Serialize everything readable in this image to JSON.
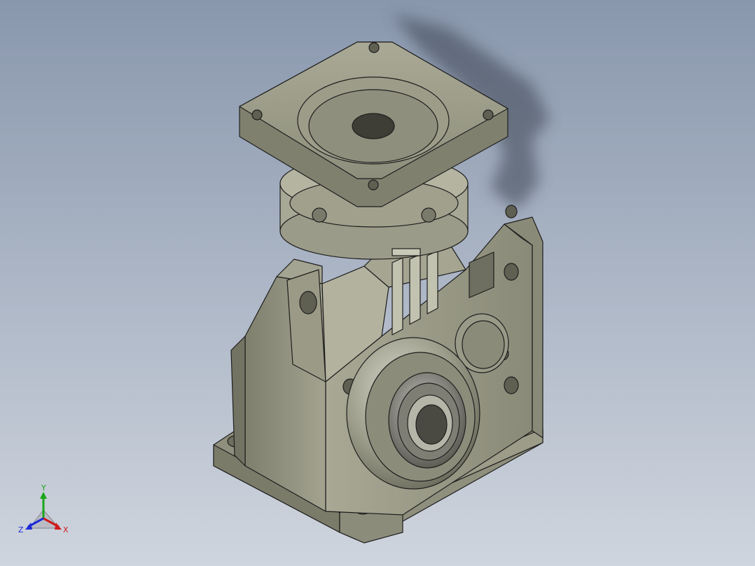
{
  "viewport": {
    "background_top": "#8997ad",
    "background_bottom": "#cfd5de",
    "model_body_color": "#9a9a86",
    "model_edge_color": "#1e1e1e"
  },
  "triad": {
    "x_label": "X",
    "y_label": "Y",
    "z_label": "Z",
    "x_color": "#d11a1a",
    "y_color": "#1aa51a",
    "z_color": "#1f2ad8"
  }
}
